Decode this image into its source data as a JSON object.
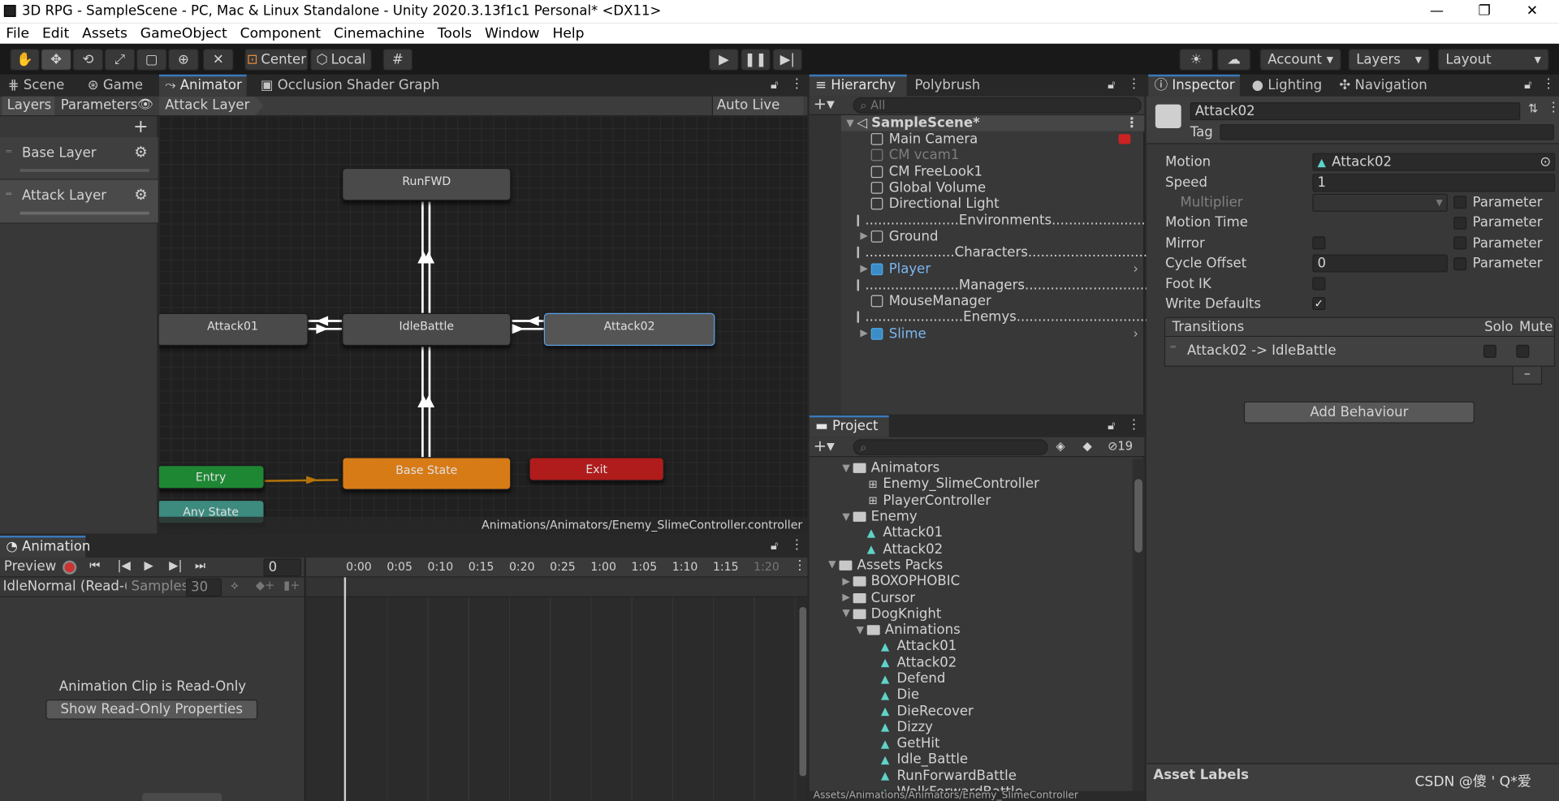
{
  "window": {
    "title": "3D RPG - SampleScene - PC, Mac & Linux Standalone - Unity 2020.3.13f1c1 Personal* <DX11>",
    "minimize": "—",
    "maximize": "❐",
    "close": "✕"
  },
  "menu": [
    "File",
    "Edit",
    "Assets",
    "GameObject",
    "Component",
    "Cinemachine",
    "Tools",
    "Window",
    "Help"
  ],
  "toolbar": {
    "center": "Center",
    "local": "Local",
    "account": "Account",
    "layers": "Layers",
    "layout": "Layout"
  },
  "animator": {
    "tabs": [
      "Scene",
      "Game",
      "Animator",
      "Occlusion Shader Graph"
    ],
    "subtabs": [
      "Layers",
      "Parameters"
    ],
    "breadcrumb": "Attack Layer",
    "auto_live_link": "Auto Live Link",
    "layers": [
      "Base Layer",
      "Attack Layer"
    ],
    "add": "+",
    "nodes": {
      "runfwd": "RunFWD",
      "attack01": "Attack01",
      "idlebattle": "IdleBattle",
      "attack02": "Attack02",
      "entry": "Entry",
      "base_state": "Base State",
      "exit": "Exit",
      "any_state": "Any State"
    },
    "path": "Animations/Animators/Enemy_SlimeController.controller"
  },
  "animation": {
    "tab": "Animation",
    "preview": "Preview",
    "frame": "0",
    "clip": "IdleNormal (Read-(",
    "samples_label": "Samples",
    "samples": "30",
    "ticks": [
      "0:00",
      "0:05",
      "0:10",
      "0:15",
      "0:20",
      "0:25",
      "1:00",
      "1:05",
      "1:10",
      "1:15",
      "1:20"
    ],
    "readonly": "Animation Clip is Read-Only",
    "show_btn": "Show Read-Only Properties"
  },
  "hierarchy": {
    "tabs": [
      "Hierarchy",
      "Polybrush"
    ],
    "search_placeholder": "All",
    "scene": "SampleScene*",
    "items": [
      {
        "name": "Main Camera",
        "style": "normal",
        "arrow": ""
      },
      {
        "name": "CM vcam1",
        "style": "dim",
        "arrow": ""
      },
      {
        "name": "CM FreeLook1",
        "style": "normal",
        "arrow": ""
      },
      {
        "name": "Global Volume",
        "style": "normal",
        "arrow": ""
      },
      {
        "name": "Directional Light",
        "style": "normal",
        "arrow": ""
      },
      {
        "name": "......................Environments...............................",
        "style": "normal",
        "arrow": ""
      },
      {
        "name": "Ground",
        "style": "normal",
        "arrow": "▶"
      },
      {
        "name": ".....................Characters................................",
        "style": "normal",
        "arrow": ""
      },
      {
        "name": "Player",
        "style": "blue",
        "arrow": "▶"
      },
      {
        "name": "......................Managers................................",
        "style": "normal",
        "arrow": ""
      },
      {
        "name": "MouseManager",
        "style": "normal",
        "arrow": ""
      },
      {
        "name": ".......................Enemys...............................",
        "style": "normal",
        "arrow": ""
      },
      {
        "name": "Slime",
        "style": "blue",
        "arrow": "▶"
      }
    ]
  },
  "project": {
    "tab": "Project",
    "count": "19",
    "items": [
      {
        "name": "Animators",
        "type": "folder",
        "indent": 1,
        "arrow": "▼"
      },
      {
        "name": "Enemy_SlimeController",
        "type": "ctrl",
        "indent": 2,
        "arrow": ""
      },
      {
        "name": "PlayerController",
        "type": "ctrl",
        "indent": 2,
        "arrow": ""
      },
      {
        "name": "Enemy",
        "type": "folder",
        "indent": 1,
        "arrow": "▼"
      },
      {
        "name": "Attack01",
        "type": "anim",
        "indent": 2,
        "arrow": ""
      },
      {
        "name": "Attack02",
        "type": "anim",
        "indent": 2,
        "arrow": ""
      },
      {
        "name": "Assets Packs",
        "type": "folder",
        "indent": 0,
        "arrow": "▼"
      },
      {
        "name": "BOXOPHOBIC",
        "type": "folder",
        "indent": 1,
        "arrow": "▶"
      },
      {
        "name": "Cursor",
        "type": "folder",
        "indent": 1,
        "arrow": "▶"
      },
      {
        "name": "DogKnight",
        "type": "folder",
        "indent": 1,
        "arrow": "▼"
      },
      {
        "name": "Animations",
        "type": "folder",
        "indent": 2,
        "arrow": "▼"
      },
      {
        "name": "Attack01",
        "type": "anim",
        "indent": 3,
        "arrow": ""
      },
      {
        "name": "Attack02",
        "type": "anim",
        "indent": 3,
        "arrow": ""
      },
      {
        "name": "Defend",
        "type": "anim",
        "indent": 3,
        "arrow": ""
      },
      {
        "name": "Die",
        "type": "anim",
        "indent": 3,
        "arrow": ""
      },
      {
        "name": "DieRecover",
        "type": "anim",
        "indent": 3,
        "arrow": ""
      },
      {
        "name": "Dizzy",
        "type": "anim",
        "indent": 3,
        "arrow": ""
      },
      {
        "name": "GetHit",
        "type": "anim",
        "indent": 3,
        "arrow": ""
      },
      {
        "name": "Idle_Battle",
        "type": "anim",
        "indent": 3,
        "arrow": ""
      },
      {
        "name": "RunForwardBattle",
        "type": "anim",
        "indent": 3,
        "arrow": ""
      },
      {
        "name": "WalkForwardBattle",
        "type": "anim",
        "indent": 3,
        "arrow": ""
      }
    ],
    "bottom_path": "Assets/Animations/Animators/Enemy_SlimeController"
  },
  "inspector": {
    "tabs": [
      "Inspector",
      "Lighting",
      "Navigation"
    ],
    "name": "Attack02",
    "tag_label": "Tag",
    "motion_label": "Motion",
    "motion_value": "Attack02",
    "speed_label": "Speed",
    "speed_value": "1",
    "multiplier_label": "Multiplier",
    "motion_time_label": "Motion Time",
    "mirror_label": "Mirror",
    "cycle_offset_label": "Cycle Offset",
    "cycle_offset_value": "0",
    "foot_ik_label": "Foot IK",
    "write_defaults_label": "Write Defaults",
    "parameter": "Parameter",
    "transitions_label": "Transitions",
    "solo": "Solo",
    "mute": "Mute",
    "transition": "Attack02 -> IdleBattle",
    "minus": "–",
    "add_behaviour": "Add Behaviour",
    "asset_labels": "Asset Labels"
  },
  "watermark": "CSDN @傻  ' Q*爱"
}
